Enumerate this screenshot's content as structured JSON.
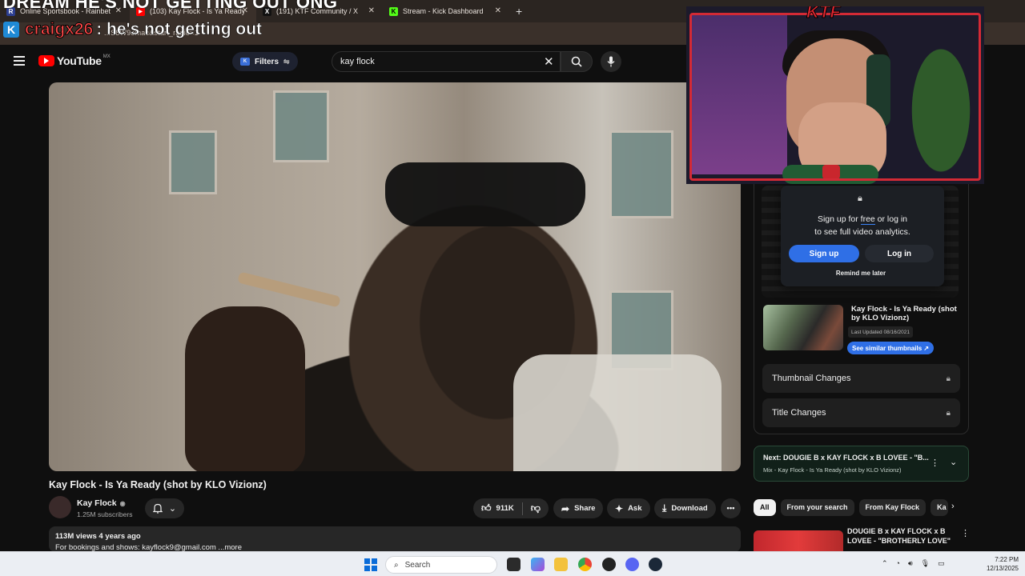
{
  "browser": {
    "tabs": [
      {
        "label": "Online Sportsbook - Rainbet",
        "favicon": "R",
        "color": "#2c3e90"
      },
      {
        "label": "(103) Kay Flock - Is Ya Ready (s",
        "favicon": "▶",
        "color": "#ff0000"
      },
      {
        "label": "(191) KTF Community / X",
        "favicon": "X",
        "color": "#111111"
      },
      {
        "label": "Stream - Kick Dashboard",
        "favicon": "K",
        "color": "#53fc18"
      }
    ],
    "url": "...S8W9emac&start_radio=1"
  },
  "stream_overlay": {
    "banner": "DREAM HE'S NOT GETTING OUT ONG",
    "chat_user": "craigx26",
    "chat_message": ": he's not getting out",
    "cam_logo": "KTF"
  },
  "youtube": {
    "logo_text": "YouTube",
    "country": "MX",
    "filters_label": "Filters",
    "search_value": "kay flock"
  },
  "video": {
    "title": "Kay Flock - Is Ya Ready (shot by KLO Vizionz)",
    "channel": "Kay Flock",
    "subscribers": "1.25M subscribers",
    "likes": "911K",
    "share": "Share",
    "ask": "Ask",
    "download": "Download",
    "views": "113M views  4 years ago",
    "description": "For bookings and shows: kayflock9@gmail.com ...more"
  },
  "analytics": {
    "line1_pre": "Sign up for ",
    "line1_link": "free",
    "line1_post": " or log in",
    "line2": "to see full video analytics.",
    "signup": "Sign up",
    "login": "Log in",
    "remind": "Remind me later",
    "thumb_title": "Kay Flock - Is Ya Ready (shot by KLO Vizionz)",
    "last_updated": "Last Updated 08/16/2021",
    "similar": "See similar thumbnails ↗",
    "rows": [
      "Thumbnail Changes",
      "Title Changes"
    ]
  },
  "next": {
    "label": "Next: DOUGIE B x KAY FLOCK x B LOVEE - \"B...",
    "sub": "Mix - Kay Flock - Is Ya Ready (shot by KLO Vizionz)"
  },
  "chips": [
    "All",
    "From your search",
    "From Kay Flock",
    "Ka"
  ],
  "recommended": {
    "title": "DOUGIE B x KAY FLOCK x B LOVEE - \"BROTHERLY LOVE\" ..."
  },
  "taskbar": {
    "search": "Search",
    "time": "7:22 PM",
    "date": "12/13/2025"
  }
}
